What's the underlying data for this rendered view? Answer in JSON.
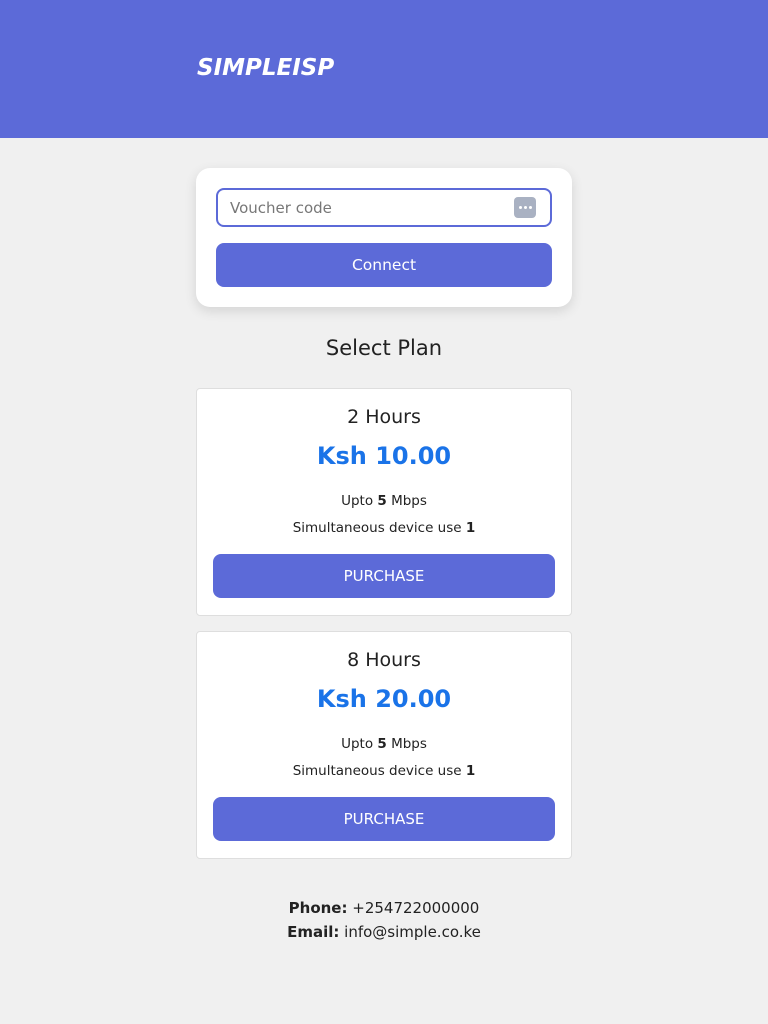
{
  "header": {
    "logo_text": "SIMPLEISP",
    "background_color": "#5c6ad8"
  },
  "voucher": {
    "placeholder": "Voucher code",
    "value": "",
    "field_icon": "password-dots-icon",
    "connect_label": "Connect"
  },
  "plans_section": {
    "title": "Select Plan"
  },
  "plans": [
    {
      "name": "2 Hours",
      "price": "Ksh 10.00",
      "speed_prefix": "Upto",
      "speed_value": "5",
      "speed_unit": "Mbps",
      "devices_label": "Simultaneous device use",
      "devices_value": "1",
      "button_label": "PURCHASE"
    },
    {
      "name": "8 Hours",
      "price": "Ksh 20.00",
      "speed_prefix": "Upto",
      "speed_value": "5",
      "speed_unit": "Mbps",
      "devices_label": "Simultaneous device use",
      "devices_value": "1",
      "button_label": "PURCHASE"
    }
  ],
  "footer": {
    "phone_label": "Phone:",
    "phone_value": "+254722000000",
    "email_label": "Email:",
    "email_value": "info@simple.co.ke"
  },
  "colors": {
    "accent": "#5c6ad8",
    "price": "#1a73e8",
    "page_background": "#f0f0f0"
  }
}
